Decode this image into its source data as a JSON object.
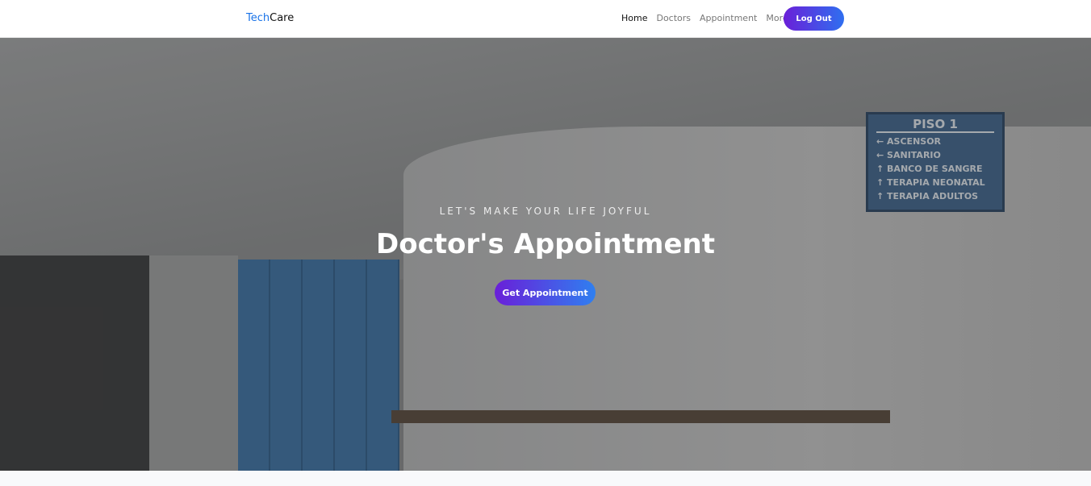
{
  "nav": {
    "brand_a": "Tech",
    "brand_b": "Care",
    "links": [
      "Home",
      "Doctors",
      "Appointment",
      "More"
    ],
    "logout": "Log Out"
  },
  "hero": {
    "subtitle": "LET'S MAKE YOUR LIFE JOYFUL",
    "title": "Doctor's Appointment",
    "cta": "Get Appointment",
    "sign": {
      "title": "PISO 1",
      "items": [
        "← ASCENSOR",
        "← SANITARIO",
        "↑ BANCO DE SANGRE",
        "↑ TERAPIA NEONATAL",
        "↑ TERAPIA ADULTOS"
      ]
    }
  },
  "colors": {
    "brand": "#1a73e8",
    "button_start": "#6a1fd8",
    "button_end": "#2f6ff0"
  }
}
